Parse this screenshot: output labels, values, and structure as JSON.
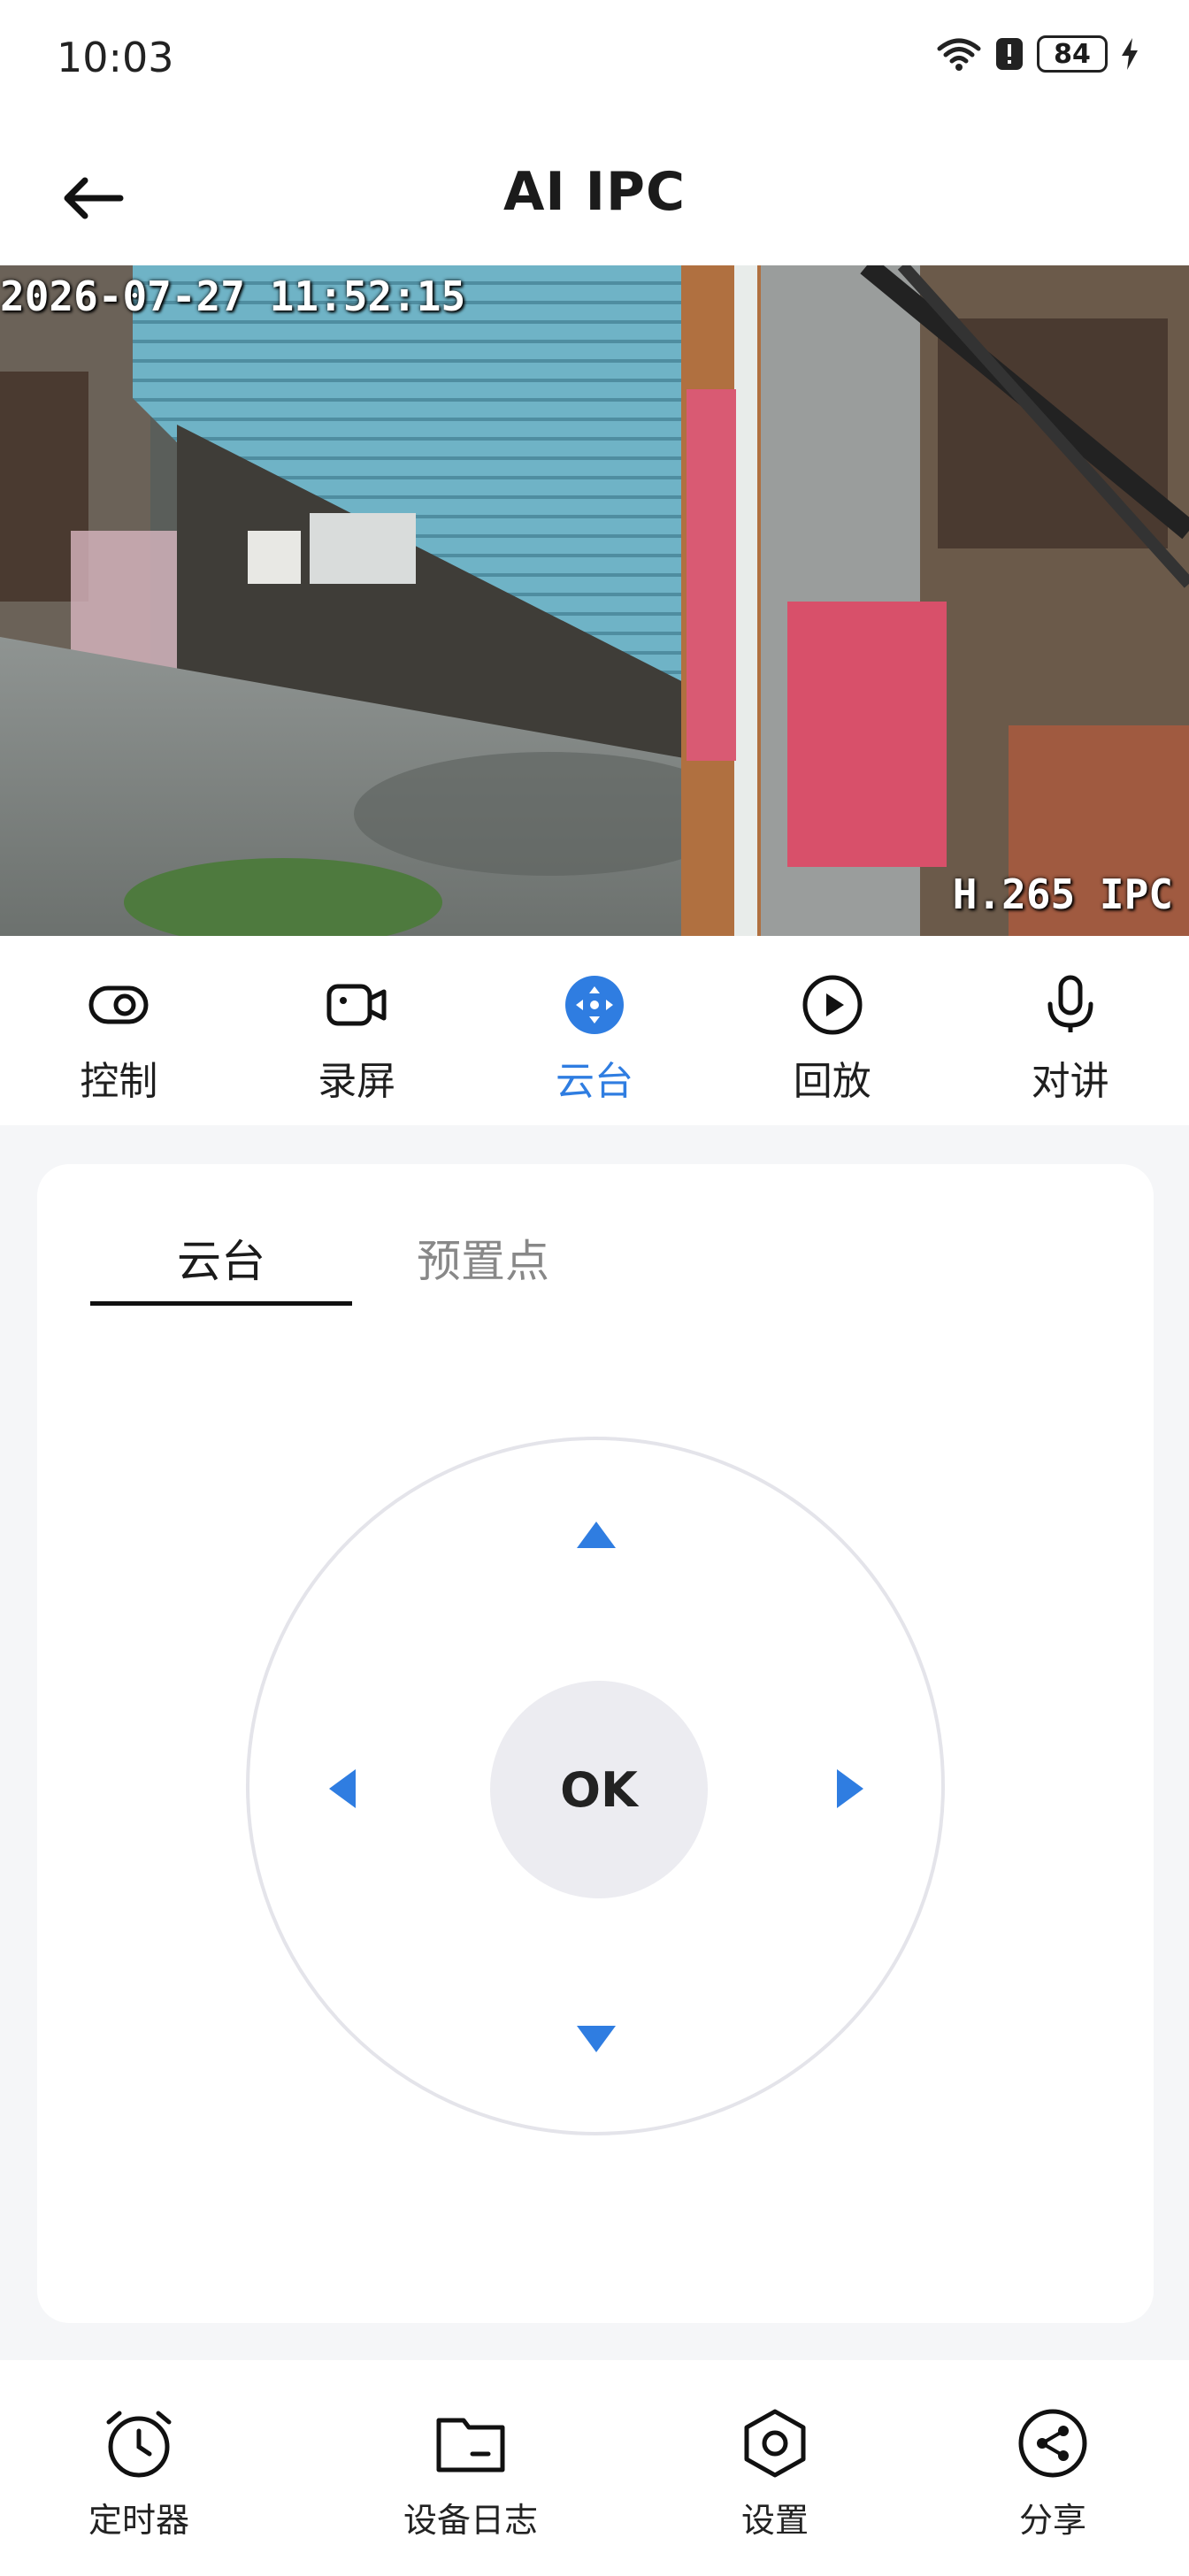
{
  "status_bar": {
    "time": "10:03",
    "battery": "84"
  },
  "app_bar": {
    "title": "AI IPC"
  },
  "video": {
    "timestamp": "2026-07-27 11:52:15",
    "codec": "H.265 IPC"
  },
  "function_tabs": [
    {
      "label": "控制",
      "icon": "toggle-icon"
    },
    {
      "label": "录屏",
      "icon": "video-record-icon"
    },
    {
      "label": "云台",
      "icon": "ptz-icon",
      "active": true
    },
    {
      "label": "回放",
      "icon": "play-icon"
    },
    {
      "label": "对讲",
      "icon": "microphone-icon"
    }
  ],
  "ptz_panel": {
    "tabs": [
      {
        "label": "云台",
        "active": true
      },
      {
        "label": "预置点"
      }
    ],
    "ok_label": "OK",
    "accent": "#2f7de1"
  },
  "bottom_nav": [
    {
      "label": "定时器",
      "icon": "alarm-clock-icon"
    },
    {
      "label": "设备日志",
      "icon": "folder-icon"
    },
    {
      "label": "设置",
      "icon": "settings-hexagon-icon"
    },
    {
      "label": "分享",
      "icon": "share-icon"
    }
  ]
}
